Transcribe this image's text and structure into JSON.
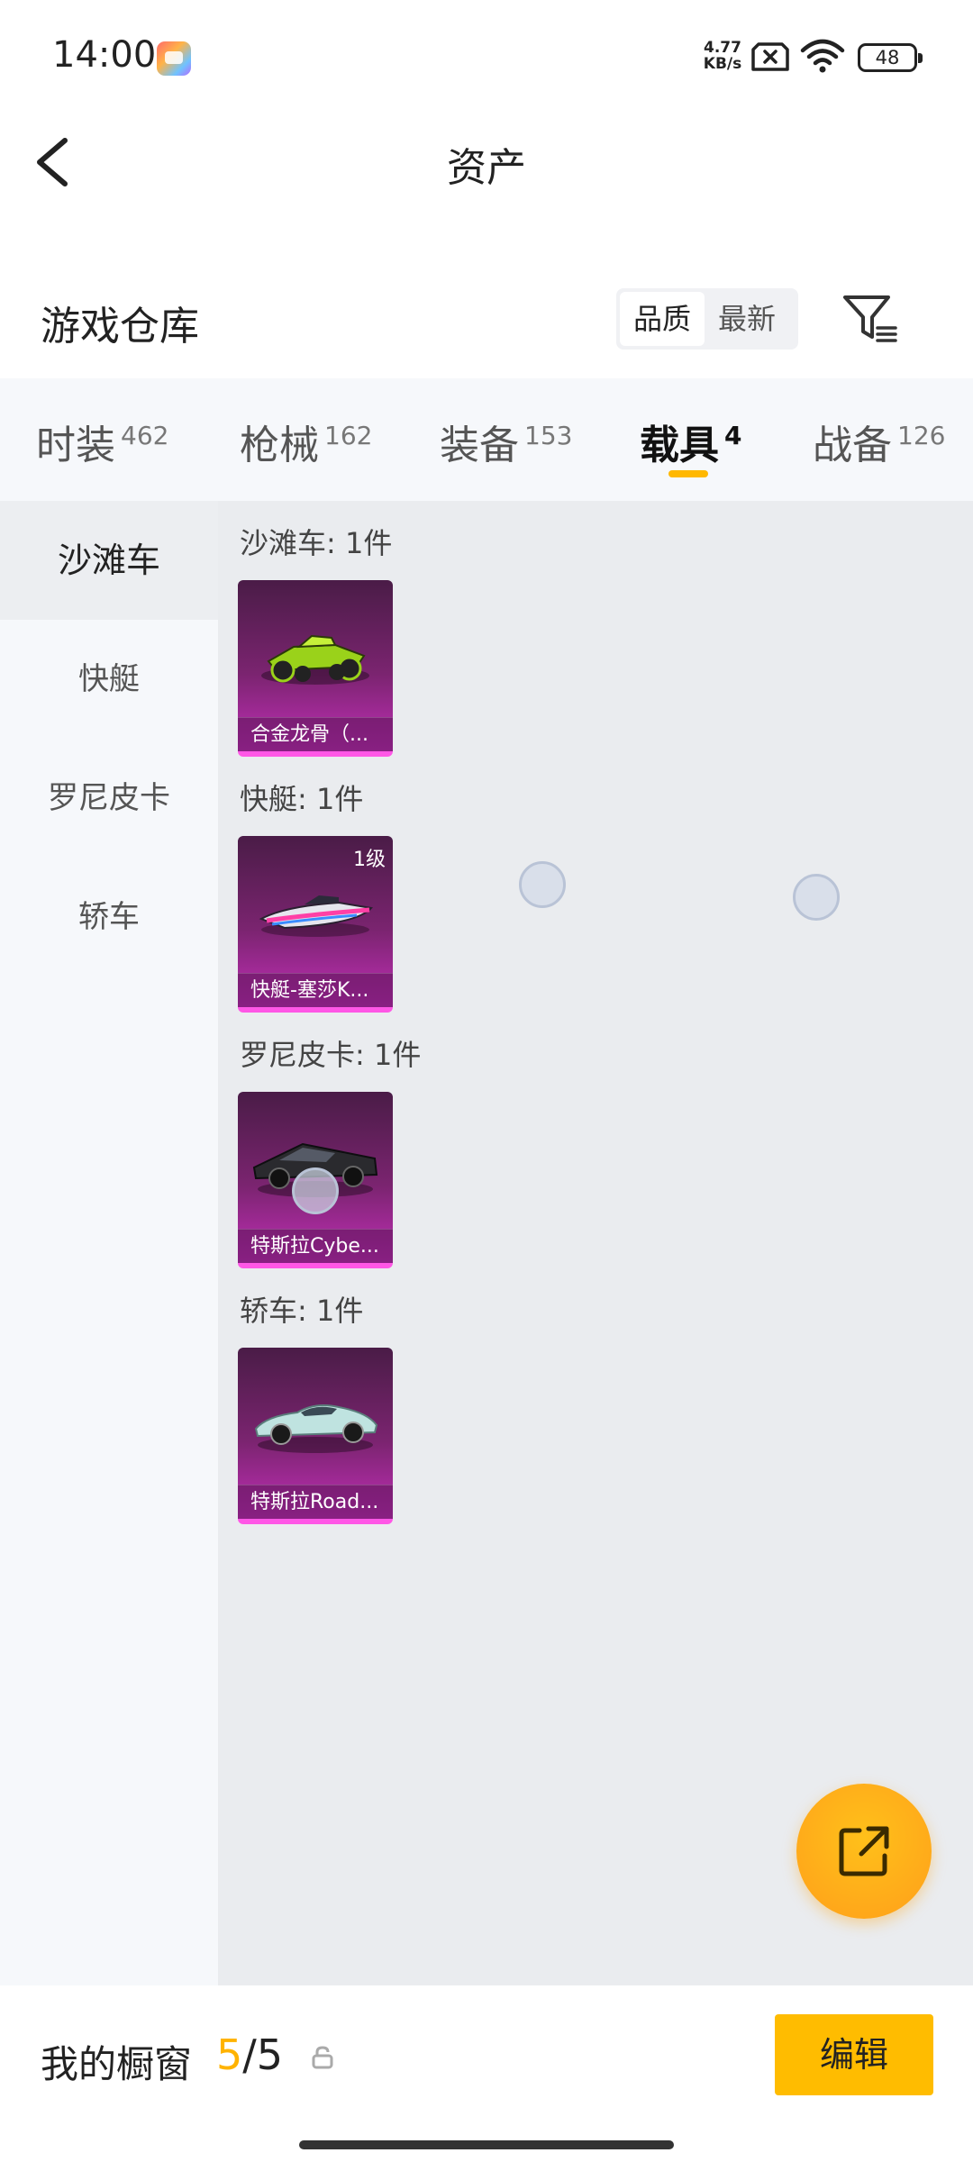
{
  "status_bar": {
    "time": "14:00",
    "net_speed_value": "4.77",
    "net_speed_unit": "KB/s",
    "battery": "48",
    "icons": [
      "gallery-app-icon",
      "sim-x-icon",
      "wifi-icon",
      "battery-icon"
    ]
  },
  "header": {
    "title": "资产",
    "back_icon": "chevron-left-icon"
  },
  "warehouse": {
    "title": "游戏仓库",
    "sort_options": [
      "品质",
      "最新"
    ],
    "sort_selected": "品质",
    "filter_icon": "filter-icon"
  },
  "tabs": [
    {
      "label": "时装",
      "count": "462"
    },
    {
      "label": "枪械",
      "count": "162"
    },
    {
      "label": "装备",
      "count": "153"
    },
    {
      "label": "载具",
      "count": "4",
      "active": true
    },
    {
      "label": "战备",
      "count": "126"
    }
  ],
  "side_nav": [
    {
      "label": "沙滩车",
      "active": true
    },
    {
      "label": "快艇"
    },
    {
      "label": "罗尼皮卡"
    },
    {
      "label": "轿车"
    }
  ],
  "groups": [
    {
      "label": "沙滩车: 1件",
      "items": [
        {
          "name": "合金龙骨（..."
        }
      ]
    },
    {
      "label": "快艇: 1件",
      "items": [
        {
          "name": "快艇-塞莎K...",
          "level": "1级"
        }
      ]
    },
    {
      "label": "罗尼皮卡: 1件",
      "items": [
        {
          "name": "特斯拉Cybe..."
        }
      ]
    },
    {
      "label": "轿车: 1件",
      "items": [
        {
          "name": "特斯拉Road..."
        }
      ]
    }
  ],
  "colors": {
    "accent": "#ffb800",
    "card_gradient_top": "#4a1c47",
    "card_gradient_bottom": "#c22fb8",
    "content_bg": "#eaecef",
    "side_bg": "#f6f8fb"
  },
  "fab": {
    "icon": "share-external-icon"
  },
  "bottom_bar": {
    "showcase_label": "我的橱窗",
    "showcase_current": "5",
    "showcase_total": "/5",
    "lock_icon": "lock-icon",
    "edit_label": "编辑"
  }
}
